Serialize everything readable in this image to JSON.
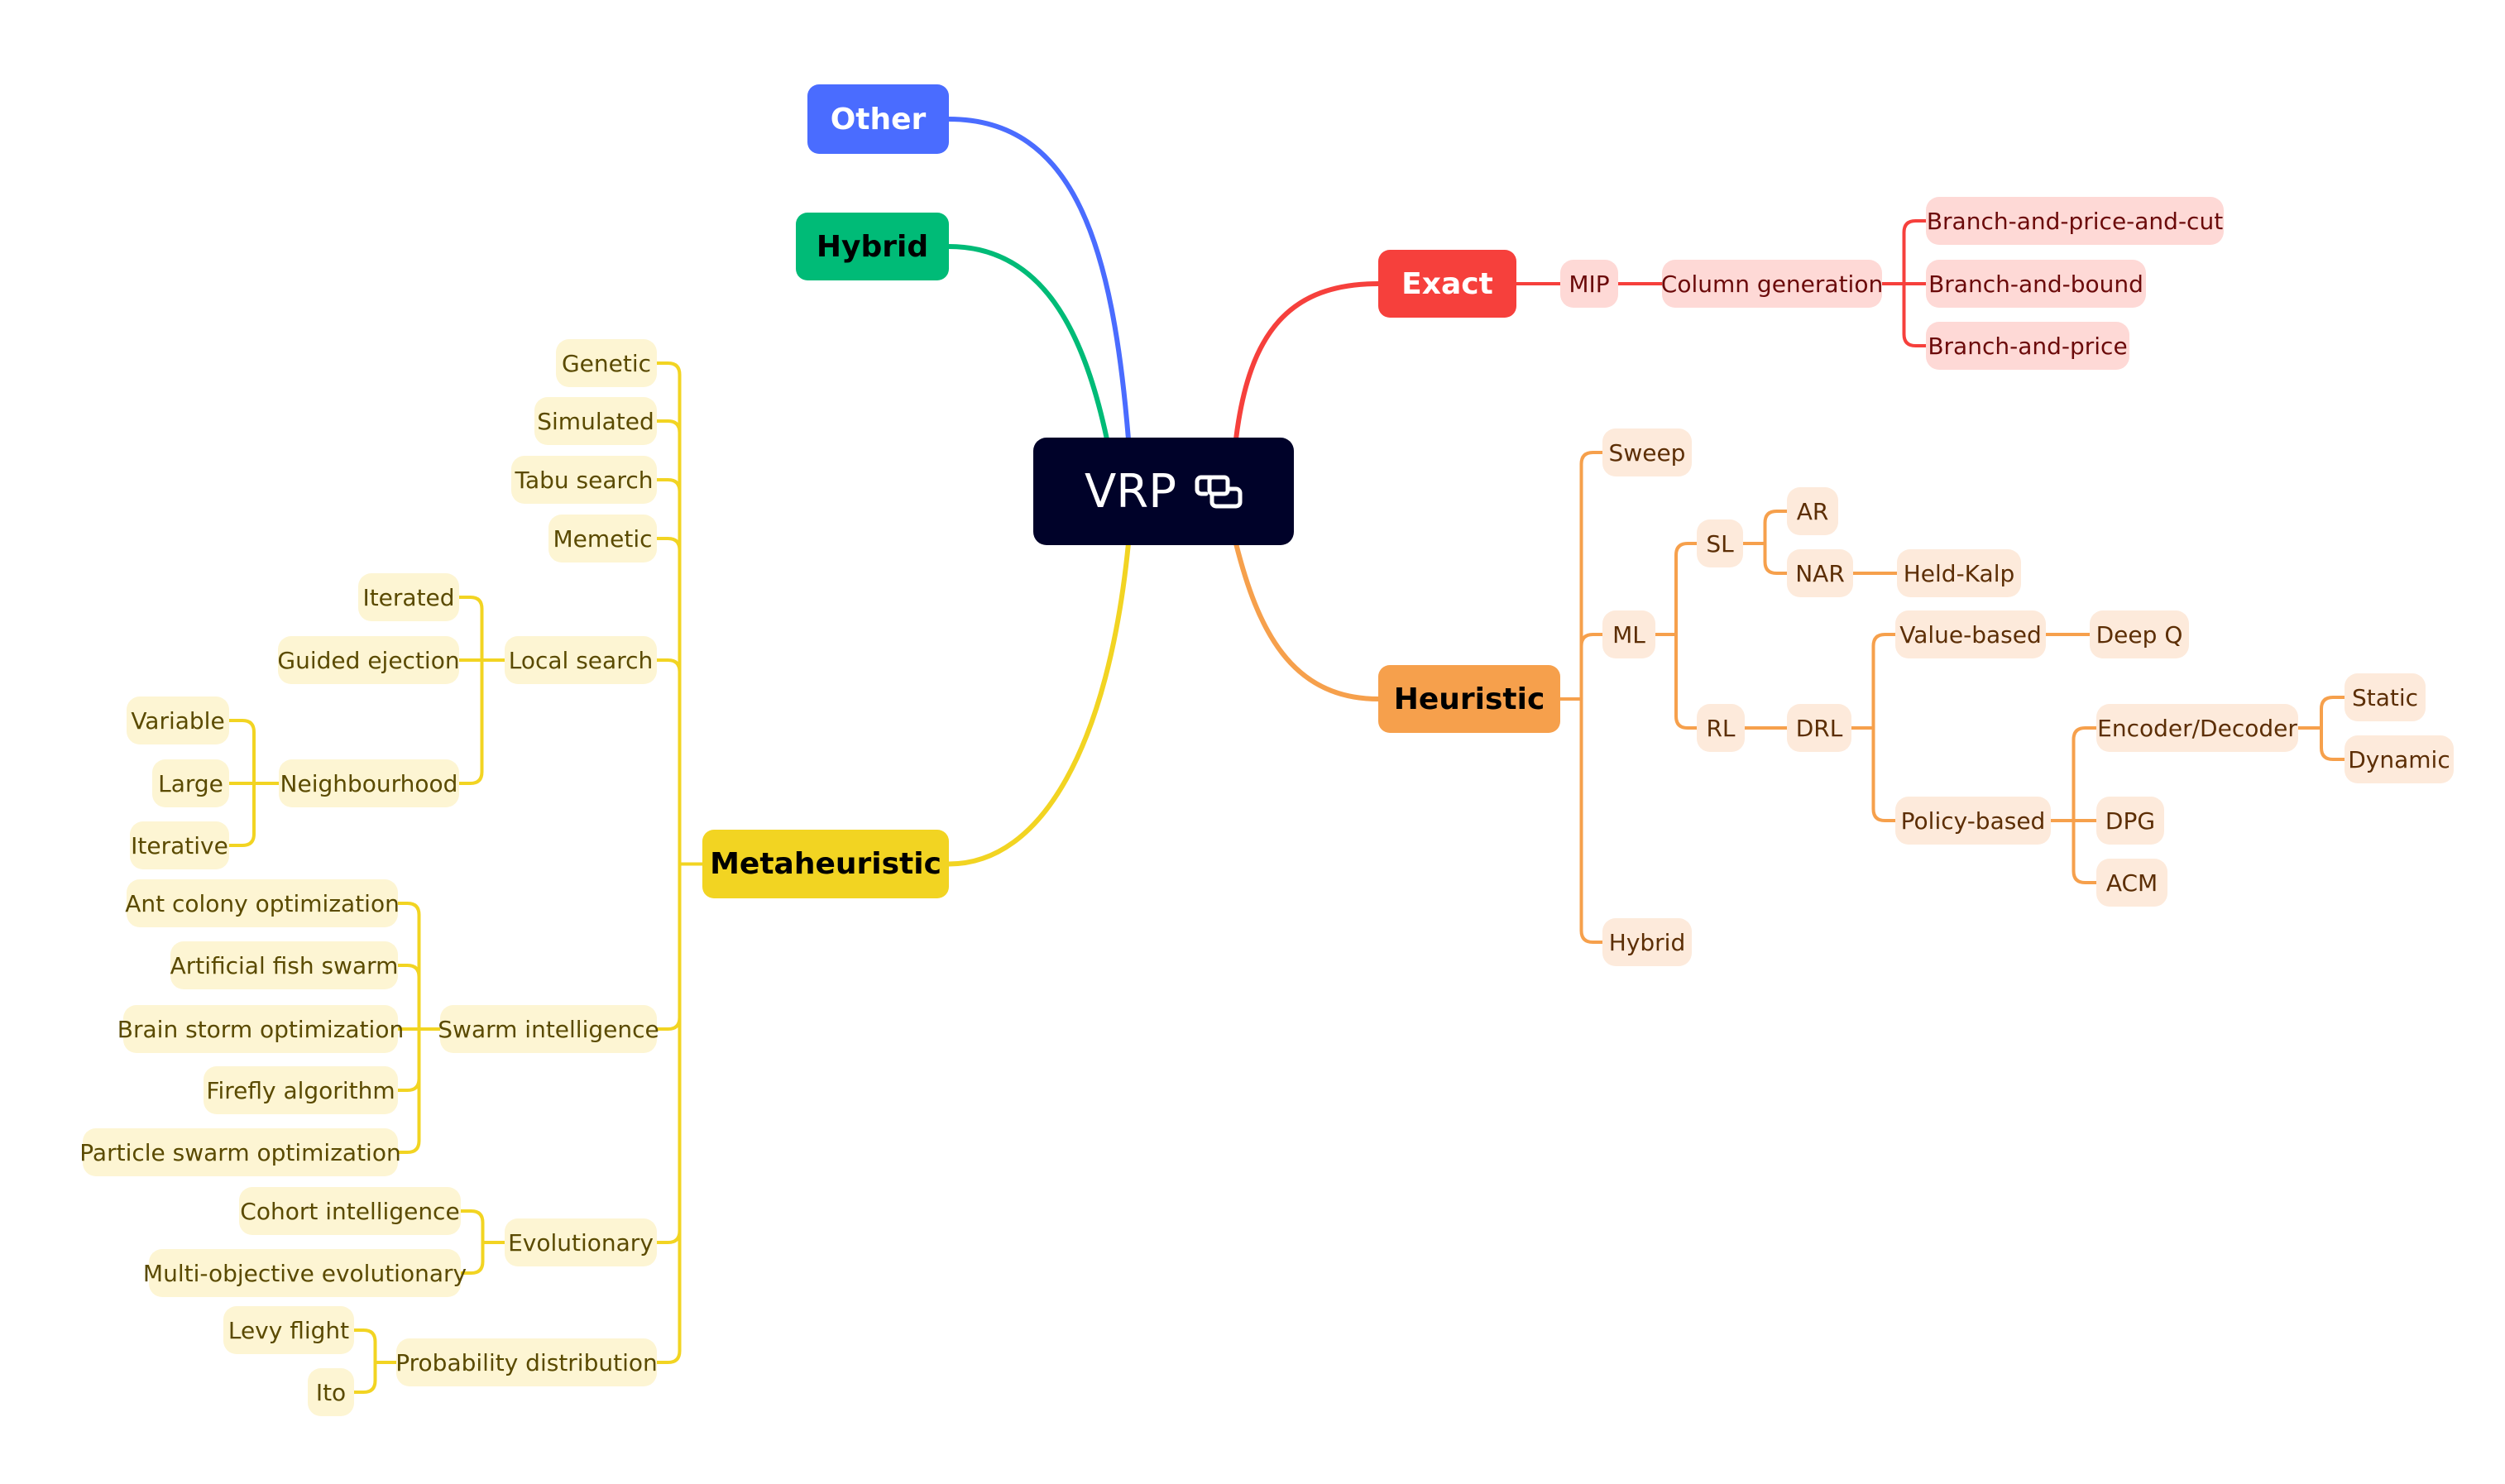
{
  "root": {
    "label": "VRP",
    "icon": "link-icon"
  },
  "colors": {
    "other": "#4a6cff",
    "hybrid": "#00bb77",
    "metaheuristic": "#f2d422",
    "exact": "#f6403c",
    "heuristic": "#f6a04c",
    "root_bg": "#000229"
  },
  "branches": {
    "other": {
      "label": "Other"
    },
    "hybrid": {
      "label": "Hybrid"
    },
    "exact": {
      "label": "Exact",
      "mip": "MIP",
      "column_generation": "Column generation",
      "children": [
        "Branch-and-price-and-cut",
        "Branch-and-bound",
        "Branch-and-price"
      ]
    },
    "heuristic": {
      "label": "Heuristic",
      "sweep": "Sweep",
      "ml": "ML",
      "sl": "SL",
      "ar": "AR",
      "nar": "NAR",
      "held_kalp": "Held-Kalp",
      "rl": "RL",
      "drl": "DRL",
      "value_based": "Value-based",
      "deep_q": "Deep Q",
      "policy_based": "Policy-based",
      "encoder_decoder": "Encoder/Decoder",
      "static": "Static",
      "dynamic": "Dynamic",
      "dpg": "DPG",
      "acm": "ACM",
      "hybrid": "Hybrid"
    },
    "metaheuristic": {
      "label": "Metaheuristic",
      "genetic": "Genetic",
      "simulated": "Simulated",
      "tabu": "Tabu search",
      "memetic": "Memetic",
      "local_search": "Local search",
      "iterated": "Iterated",
      "guided_ejection": "Guided ejection",
      "neighbourhood": "Neighbourhood",
      "variable": "Variable",
      "large": "Large",
      "iterative": "Iterative",
      "swarm": "Swarm intelligence",
      "aco": "Ant colony optimization",
      "afs": "Artificial fish swarm",
      "bso": "Brain storm optimization",
      "firefly": "Firefly algorithm",
      "pso": "Particle swarm optimization",
      "evolutionary": "Evolutionary",
      "cohort": "Cohort intelligence",
      "moe": "Multi-objective evolutionary",
      "probability": "Probability distribution",
      "levy": "Levy flight",
      "ito": "Ito"
    }
  }
}
